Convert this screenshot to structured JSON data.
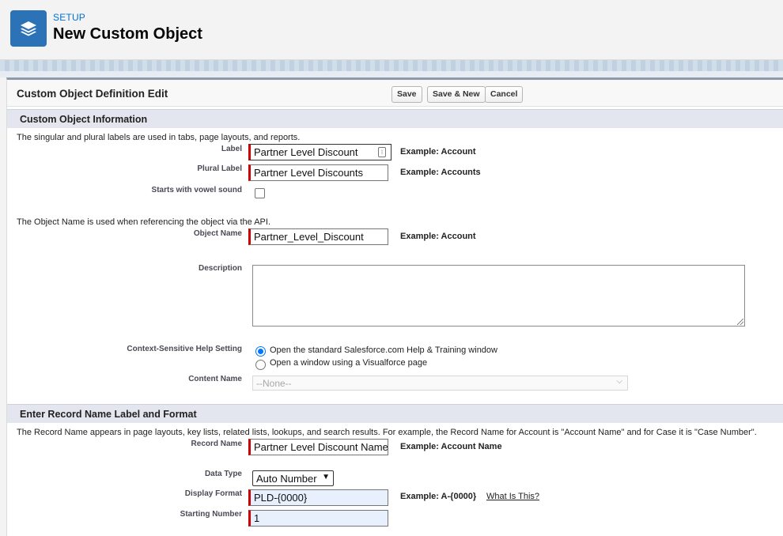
{
  "header": {
    "section_label": "SETUP",
    "title": "New Custom Object"
  },
  "panel": {
    "title": "Custom Object Definition Edit",
    "buttons": {
      "save": "Save",
      "save_new": "Save & New",
      "cancel": "Cancel"
    }
  },
  "sections": {
    "info": {
      "title": "Custom Object Information",
      "note1": "The singular and plural labels are used in tabs, page layouts, and reports.",
      "label_label": "Label",
      "label_value": "Partner Level Discount",
      "label_example": "Example:  Account",
      "plural_label": "Plural Label",
      "plural_value": "Partner Level Discounts",
      "plural_example": "Example:  Accounts",
      "vowel_label": "Starts with vowel sound",
      "vowel_checked": false,
      "note2": "The Object Name is used when referencing the object via the API.",
      "object_name_label": "Object Name",
      "object_name_value": "Partner_Level_Discount",
      "object_name_example": "Example:  Account",
      "description_label": "Description",
      "description_value": "",
      "help_label": "Context-Sensitive Help Setting",
      "help_option1": "Open the standard Salesforce.com Help & Training window",
      "help_option2": "Open a window using a Visualforce page",
      "help_selected": 1,
      "content_label": "Content Name",
      "content_value": "--None--"
    },
    "record": {
      "title": "Enter Record Name Label and Format",
      "note": "The Record Name appears in page layouts, key lists, related lists, lookups, and search results. For example, the Record Name for Account is \"Account Name\" and for Case it is \"Case Number\".",
      "record_name_label": "Record Name",
      "record_name_value": "Partner Level Discount Name",
      "record_name_example": "Example:  Account Name",
      "data_type_label": "Data Type",
      "data_type_value": "Auto Number",
      "display_format_label": "Display Format",
      "display_format_value": "PLD-{0000}",
      "display_format_example": "Example:  A-{0000}",
      "what_is_this": "What Is This?",
      "starting_number_label": "Starting Number",
      "starting_number_value": "1"
    }
  },
  "colors": {
    "brand": "#2b73b6",
    "required": "#cc0000",
    "link": "#0070d2"
  },
  "icons": {
    "app": "layers-icon",
    "lock": "lock-icon"
  }
}
